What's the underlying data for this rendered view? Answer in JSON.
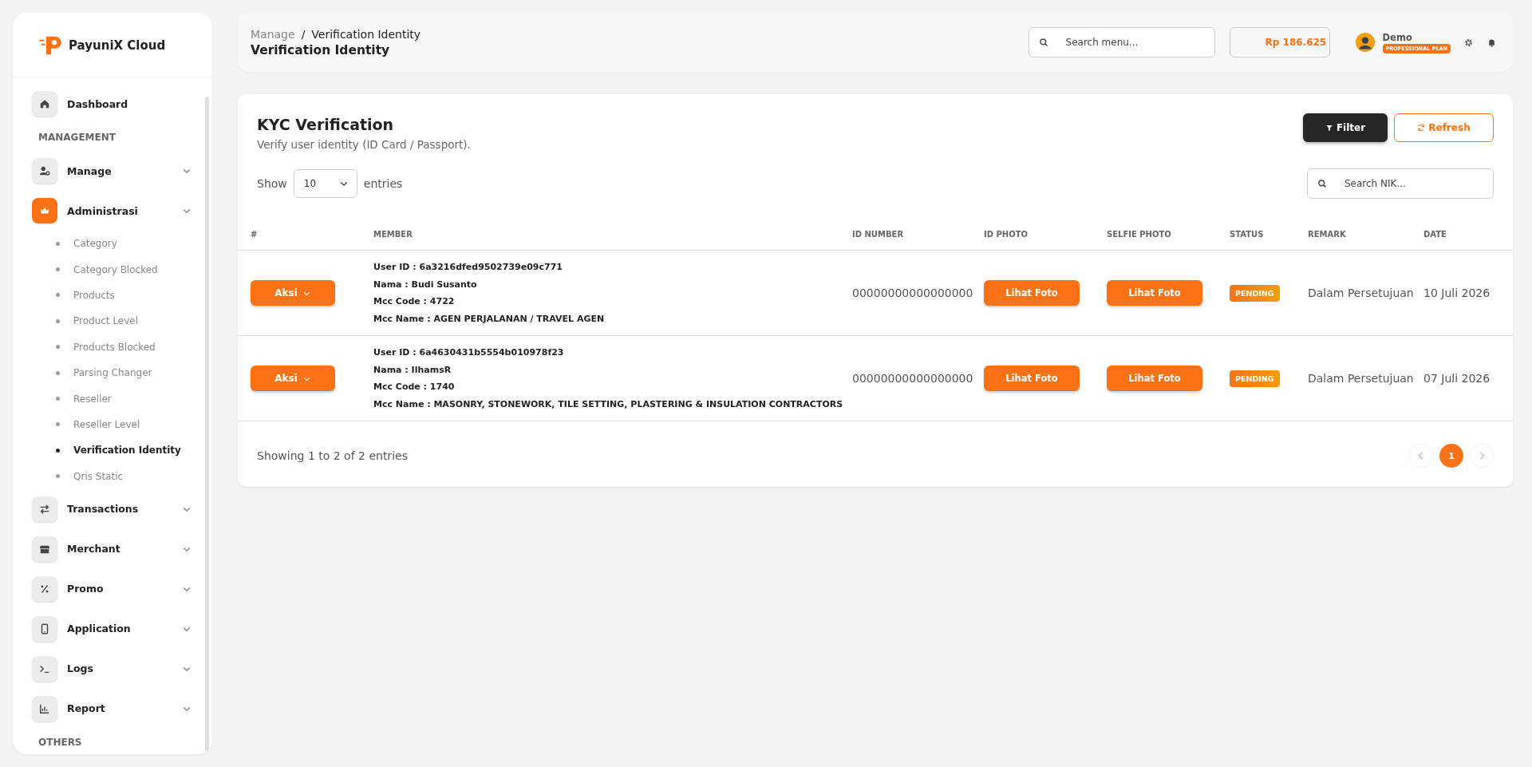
{
  "brand": {
    "name": "PayuniX Cloud"
  },
  "sidebar": {
    "items": [
      {
        "kind": "link",
        "label": "Dashboard",
        "active": false
      },
      {
        "kind": "section",
        "label": "MANAGEMENT"
      },
      {
        "kind": "group",
        "label": "Manage",
        "active": false
      },
      {
        "kind": "group",
        "label": "Administrasi",
        "active": true,
        "children": [
          {
            "label": "Category",
            "selected": false
          },
          {
            "label": "Category Blocked",
            "selected": false
          },
          {
            "label": "Products",
            "selected": false
          },
          {
            "label": "Product Level",
            "selected": false
          },
          {
            "label": "Products Blocked",
            "selected": false
          },
          {
            "label": "Parsing Changer",
            "selected": false
          },
          {
            "label": "Reseller",
            "selected": false
          },
          {
            "label": "Reseller Level",
            "selected": false
          },
          {
            "label": "Verification Identity",
            "selected": true
          },
          {
            "label": "Qris Static",
            "selected": false
          }
        ]
      },
      {
        "kind": "group",
        "label": "Transactions",
        "active": false
      },
      {
        "kind": "group",
        "label": "Merchant",
        "active": false
      },
      {
        "kind": "group",
        "label": "Promo",
        "active": false
      },
      {
        "kind": "group",
        "label": "Application",
        "active": false
      },
      {
        "kind": "group",
        "label": "Logs",
        "active": false
      },
      {
        "kind": "group",
        "label": "Report",
        "active": false
      },
      {
        "kind": "section",
        "label": "OTHERS"
      }
    ]
  },
  "header": {
    "breadcrumb": [
      "Manage",
      "Verification Identity"
    ],
    "breadcrumb_separator": "/",
    "title": "Verification Identity",
    "search": {
      "placeholder": "Search menu..."
    },
    "balance": "Rp 186.625",
    "user": {
      "name": "Demo",
      "plan": "PROFESSIONAL PLAN"
    }
  },
  "card": {
    "title": "KYC Verification",
    "subtitle": "Verify user identity (ID Card / Passport).",
    "buttons": [
      {
        "kind": "filter",
        "label": "Filter"
      },
      {
        "kind": "refresh",
        "label": "Refresh"
      }
    ],
    "show_label": "Show",
    "entries_value": "10",
    "entries_label": "entries",
    "search": {
      "placeholder": "Search NIK..."
    }
  },
  "table": {
    "columns": [
      "#",
      "MEMBER",
      "ID NUMBER",
      "ID PHOTO",
      "SELFIE PHOTO",
      "STATUS",
      "REMARK",
      "DATE"
    ],
    "rows": [
      {
        "action": "Aksi",
        "member": [
          "User ID : 6a3216dfed9502739e09c771",
          "Nama : Budi Susanto",
          "Mcc Code : 4722",
          "Mcc Name : AGEN PERJALANAN / TRAVEL AGEN"
        ],
        "id_number": "00000000000000000",
        "id_photo": "Lihat Foto",
        "selfie_photo": "Lihat Foto",
        "status": "PENDING",
        "remark": "Dalam Persetujuan",
        "date": "10 Juli 2026"
      },
      {
        "action": "Aksi",
        "member": [
          "User ID : 6a4630431b5554b010978f23",
          "Nama : IlhamsR",
          "Mcc Code : 1740",
          "Mcc Name : MASONRY, STONEWORK, TILE SETTING, PLASTERING & INSULATION CONTRACTORS"
        ],
        "id_number": "00000000000000000",
        "id_photo": "Lihat Foto",
        "selfie_photo": "Lihat Foto",
        "status": "PENDING",
        "remark": "Dalam Persetujuan",
        "date": "07 Juli 2026"
      }
    ]
  },
  "footer": {
    "info": "Showing 1 to 2 of 2 entries",
    "pages": [
      {
        "label": "1",
        "selected": true
      }
    ]
  }
}
